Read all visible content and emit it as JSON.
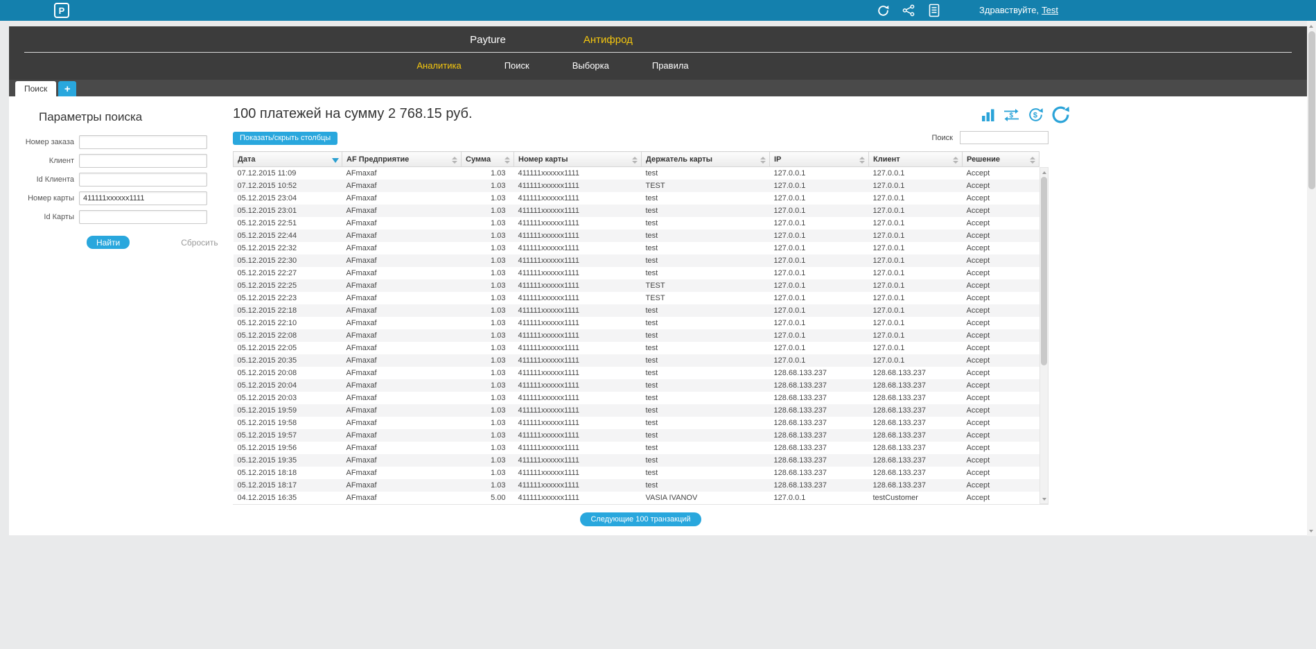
{
  "colors": {
    "topbar_blue": "#1480ad",
    "accent_blue": "#29a7dd",
    "accent_yellow": "#f5c70f",
    "nav_dark": "#3c3c3c"
  },
  "glyphs": {
    "dollar": "$"
  },
  "topbar": {
    "logo_letter": "P",
    "greeting_prefix": "Здравствуйте,",
    "username": "Test"
  },
  "icons": {
    "topbar": [
      {
        "name": "refresh-icon",
        "meaning": "refresh session"
      },
      {
        "name": "services-icon",
        "meaning": "connections / services"
      },
      {
        "name": "report-icon",
        "meaning": "document / report"
      }
    ],
    "results_toolbar": [
      {
        "name": "bar-chart-icon",
        "meaning": "analytics chart"
      },
      {
        "name": "payments-transfer-icon",
        "meaning": "payments transfer"
      },
      {
        "name": "currency-exchange-icon",
        "meaning": "currency exchange"
      },
      {
        "name": "reload-icon",
        "meaning": "reload results"
      }
    ]
  },
  "nav": {
    "primary": [
      {
        "label": "Payture",
        "active": false
      },
      {
        "label": "Антифрод",
        "active": true
      }
    ],
    "secondary": [
      {
        "label": "Аналитика",
        "active": true
      },
      {
        "label": "Поиск",
        "active": false
      },
      {
        "label": "Выборка",
        "active": false
      },
      {
        "label": "Правила",
        "active": false
      }
    ]
  },
  "tabs": {
    "active_label": "Поиск",
    "add_label": "+"
  },
  "search_panel": {
    "title": "Параметры поиска",
    "fields": [
      {
        "label": "Номер заказа",
        "value": ""
      },
      {
        "label": "Клиент",
        "value": ""
      },
      {
        "label": "Id Клиента",
        "value": ""
      },
      {
        "label": "Номер карты",
        "value": "411111xxxxxx1111"
      },
      {
        "label": "Id Карты",
        "value": ""
      }
    ],
    "find_label": "Найти",
    "reset_label": "Сбросить"
  },
  "results": {
    "summary": "100 платежей на сумму 2 768.15 руб.",
    "columns_button_label": "Показать/скрыть столбцы",
    "filter_label": "Поиск",
    "filter_value": "",
    "next_button_label": "Следующие 100 транзакций"
  },
  "table": {
    "columns": [
      "Дата",
      "AF Предприятие",
      "Сумма",
      "Номер карты",
      "Держатель карты",
      "IP",
      "Клиент",
      "Решение"
    ],
    "sort": {
      "column": "Дата",
      "direction": "desc"
    },
    "rows": [
      [
        "07.12.2015 11:09",
        "AFmaxaf",
        "1.03",
        "411111xxxxxx1111",
        "test",
        "127.0.0.1",
        "127.0.0.1",
        "Accept"
      ],
      [
        "07.12.2015 10:52",
        "AFmaxaf",
        "1.03",
        "411111xxxxxx1111",
        "TEST",
        "127.0.0.1",
        "127.0.0.1",
        "Accept"
      ],
      [
        "05.12.2015 23:04",
        "AFmaxaf",
        "1.03",
        "411111xxxxxx1111",
        "test",
        "127.0.0.1",
        "127.0.0.1",
        "Accept"
      ],
      [
        "05.12.2015 23:01",
        "AFmaxaf",
        "1.03",
        "411111xxxxxx1111",
        "test",
        "127.0.0.1",
        "127.0.0.1",
        "Accept"
      ],
      [
        "05.12.2015 22:51",
        "AFmaxaf",
        "1.03",
        "411111xxxxxx1111",
        "test",
        "127.0.0.1",
        "127.0.0.1",
        "Accept"
      ],
      [
        "05.12.2015 22:44",
        "AFmaxaf",
        "1.03",
        "411111xxxxxx1111",
        "test",
        "127.0.0.1",
        "127.0.0.1",
        "Accept"
      ],
      [
        "05.12.2015 22:32",
        "AFmaxaf",
        "1.03",
        "411111xxxxxx1111",
        "test",
        "127.0.0.1",
        "127.0.0.1",
        "Accept"
      ],
      [
        "05.12.2015 22:30",
        "AFmaxaf",
        "1.03",
        "411111xxxxxx1111",
        "test",
        "127.0.0.1",
        "127.0.0.1",
        "Accept"
      ],
      [
        "05.12.2015 22:27",
        "AFmaxaf",
        "1.03",
        "411111xxxxxx1111",
        "test",
        "127.0.0.1",
        "127.0.0.1",
        "Accept"
      ],
      [
        "05.12.2015 22:25",
        "AFmaxaf",
        "1.03",
        "411111xxxxxx1111",
        "TEST",
        "127.0.0.1",
        "127.0.0.1",
        "Accept"
      ],
      [
        "05.12.2015 22:23",
        "AFmaxaf",
        "1.03",
        "411111xxxxxx1111",
        "TEST",
        "127.0.0.1",
        "127.0.0.1",
        "Accept"
      ],
      [
        "05.12.2015 22:18",
        "AFmaxaf",
        "1.03",
        "411111xxxxxx1111",
        "test",
        "127.0.0.1",
        "127.0.0.1",
        "Accept"
      ],
      [
        "05.12.2015 22:10",
        "AFmaxaf",
        "1.03",
        "411111xxxxxx1111",
        "test",
        "127.0.0.1",
        "127.0.0.1",
        "Accept"
      ],
      [
        "05.12.2015 22:08",
        "AFmaxaf",
        "1.03",
        "411111xxxxxx1111",
        "test",
        "127.0.0.1",
        "127.0.0.1",
        "Accept"
      ],
      [
        "05.12.2015 22:05",
        "AFmaxaf",
        "1.03",
        "411111xxxxxx1111",
        "test",
        "127.0.0.1",
        "127.0.0.1",
        "Accept"
      ],
      [
        "05.12.2015 20:35",
        "AFmaxaf",
        "1.03",
        "411111xxxxxx1111",
        "test",
        "127.0.0.1",
        "127.0.0.1",
        "Accept"
      ],
      [
        "05.12.2015 20:08",
        "AFmaxaf",
        "1.03",
        "411111xxxxxx1111",
        "test",
        "128.68.133.237",
        "128.68.133.237",
        "Accept"
      ],
      [
        "05.12.2015 20:04",
        "AFmaxaf",
        "1.03",
        "411111xxxxxx1111",
        "test",
        "128.68.133.237",
        "128.68.133.237",
        "Accept"
      ],
      [
        "05.12.2015 20:03",
        "AFmaxaf",
        "1.03",
        "411111xxxxxx1111",
        "test",
        "128.68.133.237",
        "128.68.133.237",
        "Accept"
      ],
      [
        "05.12.2015 19:59",
        "AFmaxaf",
        "1.03",
        "411111xxxxxx1111",
        "test",
        "128.68.133.237",
        "128.68.133.237",
        "Accept"
      ],
      [
        "05.12.2015 19:58",
        "AFmaxaf",
        "1.03",
        "411111xxxxxx1111",
        "test",
        "128.68.133.237",
        "128.68.133.237",
        "Accept"
      ],
      [
        "05.12.2015 19:57",
        "AFmaxaf",
        "1.03",
        "411111xxxxxx1111",
        "test",
        "128.68.133.237",
        "128.68.133.237",
        "Accept"
      ],
      [
        "05.12.2015 19:56",
        "AFmaxaf",
        "1.03",
        "411111xxxxxx1111",
        "test",
        "128.68.133.237",
        "128.68.133.237",
        "Accept"
      ],
      [
        "05.12.2015 19:35",
        "AFmaxaf",
        "1.03",
        "411111xxxxxx1111",
        "test",
        "128.68.133.237",
        "128.68.133.237",
        "Accept"
      ],
      [
        "05.12.2015 18:18",
        "AFmaxaf",
        "1.03",
        "411111xxxxxx1111",
        "test",
        "128.68.133.237",
        "128.68.133.237",
        "Accept"
      ],
      [
        "05.12.2015 18:17",
        "AFmaxaf",
        "1.03",
        "411111xxxxxx1111",
        "test",
        "128.68.133.237",
        "128.68.133.237",
        "Accept"
      ],
      [
        "04.12.2015 16:35",
        "AFmaxaf",
        "5.00",
        "411111xxxxxx1111",
        "VASIA IVANOV",
        "127.0.0.1",
        "testCustomer",
        "Accept"
      ]
    ]
  }
}
